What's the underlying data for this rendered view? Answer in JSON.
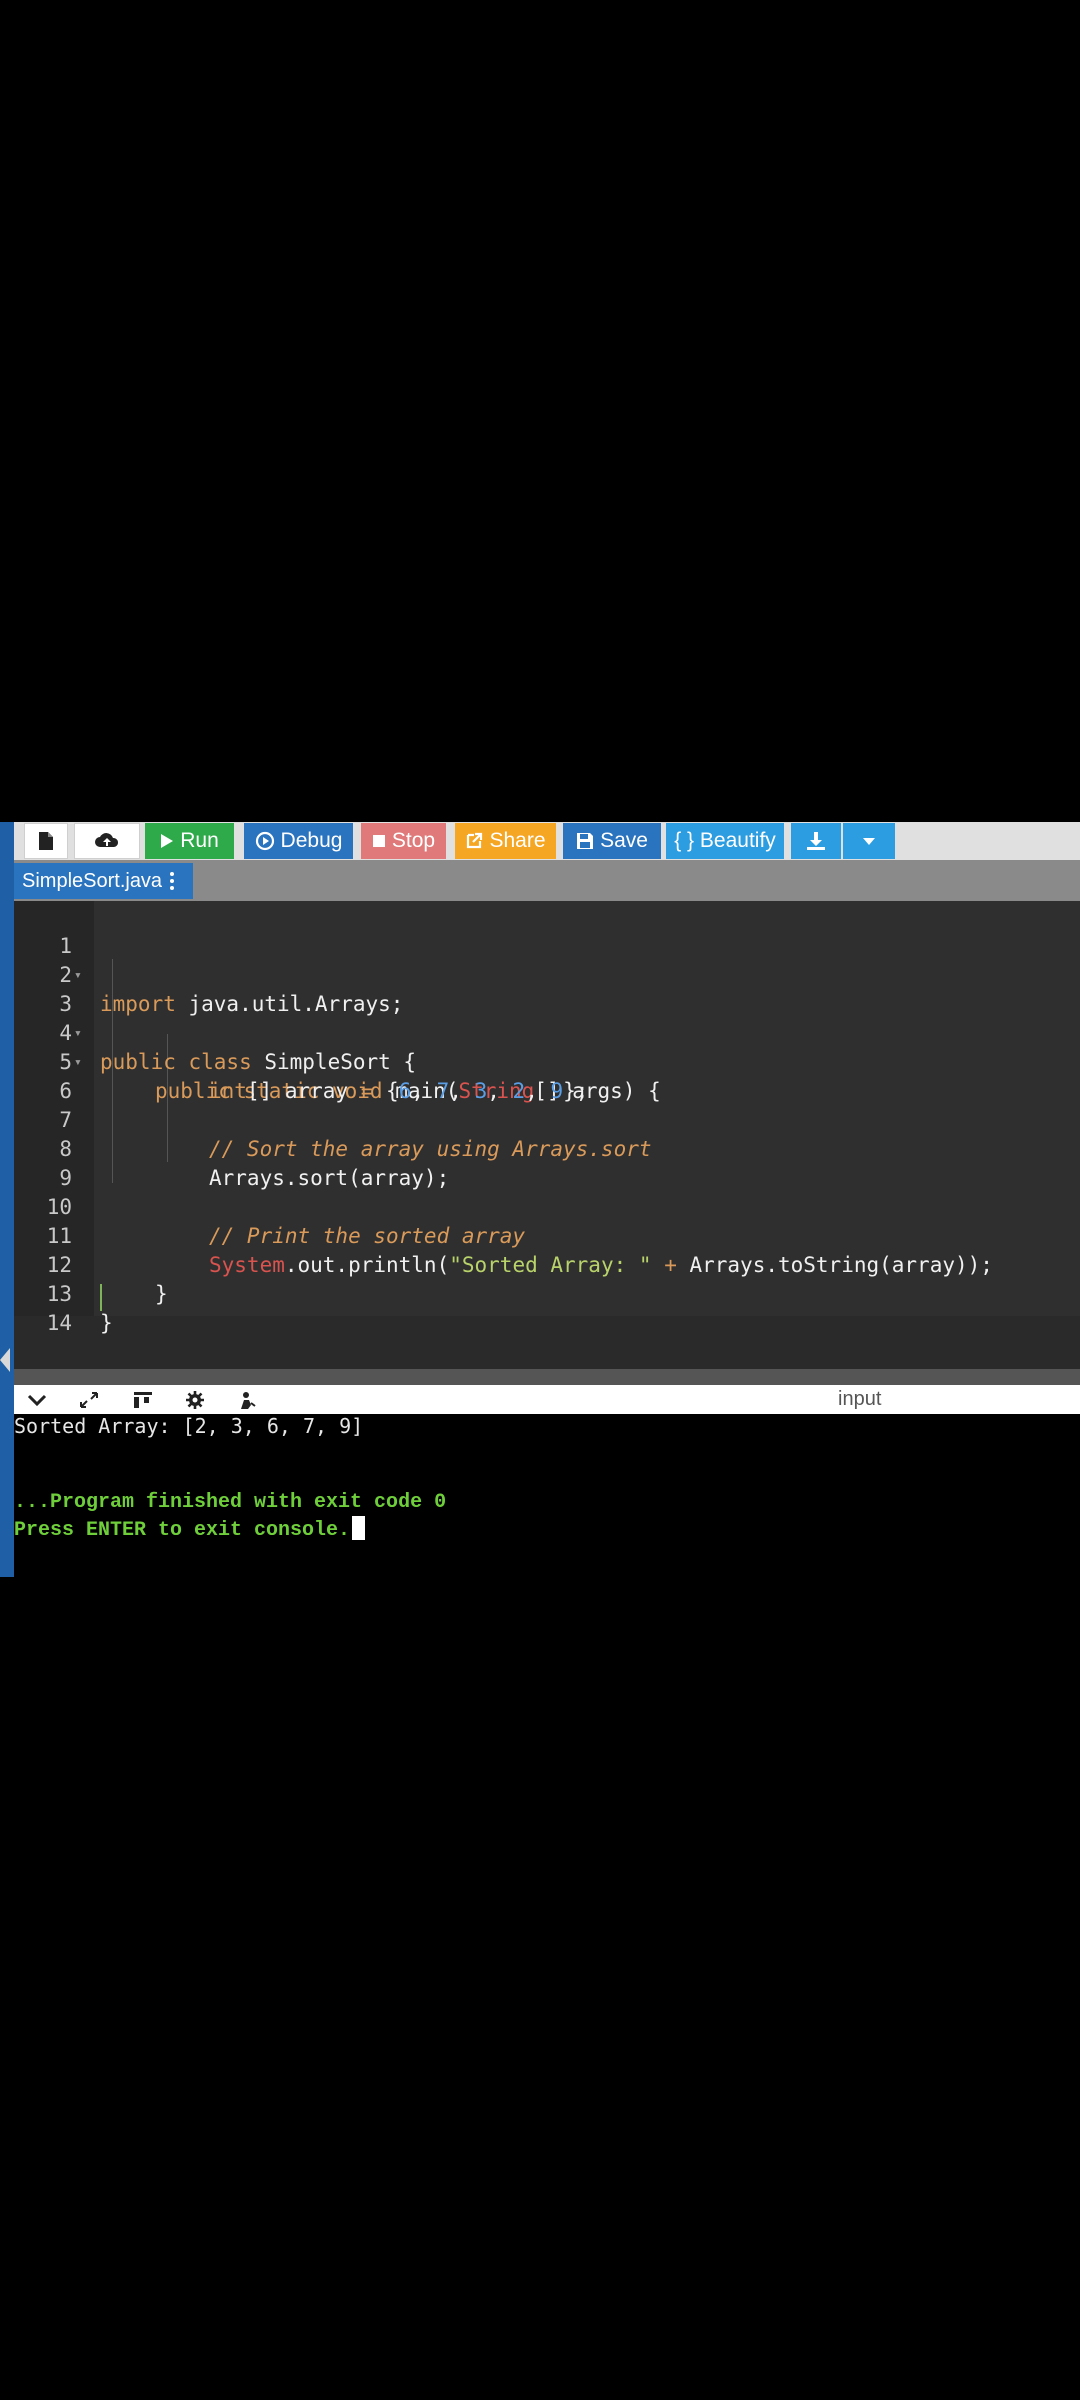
{
  "toolbar": {
    "run_label": "Run",
    "debug_label": "Debug",
    "stop_label": "Stop",
    "share_label": "Share",
    "save_label": "Save",
    "beautify_label": "{ } Beautify"
  },
  "tabs": [
    {
      "label": "SimpleSort.java"
    }
  ],
  "editor": {
    "line_numbers": [
      "1",
      "2",
      "3",
      "4",
      "5",
      "6",
      "7",
      "8",
      "9",
      "10",
      "11",
      "12",
      "13",
      "14"
    ]
  },
  "console_bar": {
    "input_label": "input"
  },
  "console": {
    "output": "Sorted Array: [2, 3, 6, 7, 9]",
    "finished": "...Program finished with exit code 0",
    "exit_prompt": "Press ENTER to exit console."
  },
  "colors": {
    "run": "#2eaa4a",
    "debug": "#2a73be",
    "stop": "#e07a7a",
    "share": "#f5a623",
    "save": "#2a73be",
    "beautify": "#2c9de0",
    "console_text": "#6fcf3a"
  },
  "code": {
    "l1_kw": "import",
    "l1_rest": " java.util.Arrays;",
    "l3_kw": "public class",
    "l3_rest": " SimpleSort {",
    "l4_kw": "public static void",
    "l4_mid": " main(",
    "l4_type": "String",
    "l4_rest": "[] args) {",
    "l5_kw": "int",
    "l5_a": "[] array ",
    "l5_eq": "=",
    "l5_b": " {",
    "l5_n1": "6",
    "l5_c1": ", ",
    "l5_n2": "7",
    "l5_c2": ", ",
    "l5_n3": "3",
    "l5_c3": ", ",
    "l5_n4": "2",
    "l5_c4": ", ",
    "l5_n5": "9",
    "l5_end": "};",
    "l7_cmt": "// Sort the array using Arrays.sort",
    "l8": "Arrays.sort(array);",
    "l10_cmt": "// Print the sorted array",
    "l11_type": "System",
    "l11_a": ".out.println(",
    "l11_str": "\"Sorted Array: \"",
    "l11_b": " ",
    "l11_op": "+",
    "l11_c": " Arrays.toString(array));",
    "l12": "}",
    "l13": "}"
  }
}
